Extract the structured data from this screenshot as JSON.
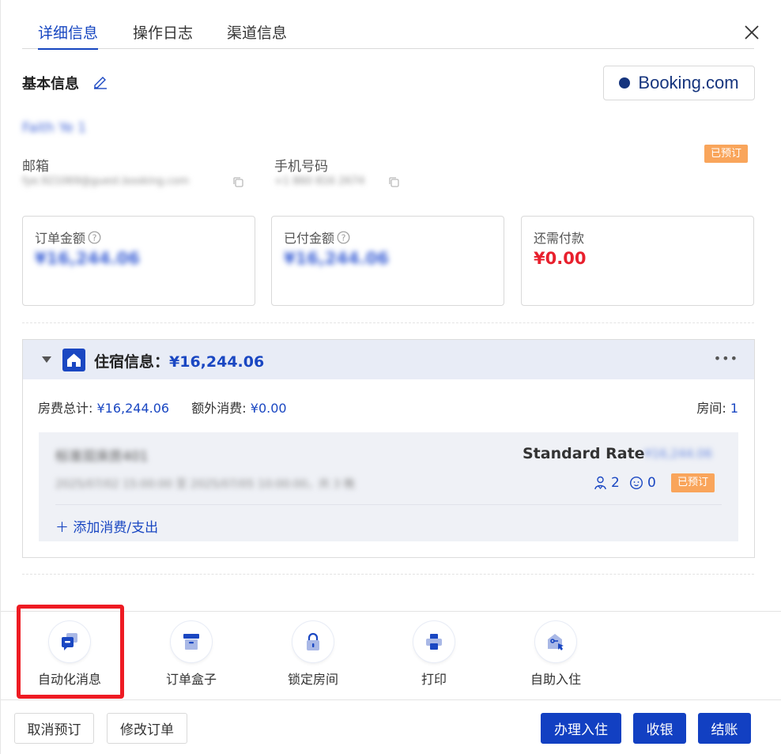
{
  "tabs": [
    "详细信息",
    "操作日志",
    "渠道信息"
  ],
  "basic": {
    "title": "基本信息",
    "channel": "Booking.com",
    "guest_name": "Faith Ye 1",
    "status": "已预订",
    "email_label": "邮箱",
    "email_value": "fye.921069@guest.booking.com",
    "phone_label": "手机号码",
    "phone_value": "+1 860 816 2674"
  },
  "amounts": {
    "order_label": "订单金额",
    "order_value": "¥16,244.06",
    "paid_label": "已付金额",
    "paid_value": "¥16,244.06",
    "due_label": "还需付款",
    "due_value": "¥0.00"
  },
  "stay": {
    "title": "住宿信息：",
    "amount": "¥16,244.06",
    "more": "•••",
    "room_fee_label": "房费总计: ",
    "room_fee_value": "¥16,244.06",
    "extra_label": "额外消费: ",
    "extra_value": "¥0.00",
    "rooms_label": "房间: ",
    "rooms_value": "1",
    "room": {
      "name": "标准双床房401",
      "rate": "Standard Rate",
      "rate_amount": "¥16,244.06",
      "dates": "2025/07/02 15:00:00 至 2025/07/05 10:00:00，共 3 晚",
      "adults": "2",
      "children": "0",
      "status": "已预订"
    },
    "add_expense": "＋ 添加消费/支出"
  },
  "toolbar": [
    "自动化消息",
    "订单盒子",
    "锁定房间",
    "打印",
    "自助入住"
  ],
  "footer": {
    "cancel": "取消预订",
    "modify": "修改订单",
    "checkin": "办理入住",
    "cashier": "收银",
    "checkout": "结账"
  },
  "colors": {
    "primary": "#1240c2",
    "tag": "#f9a55b",
    "danger": "#e8202d",
    "highlight": "#ee1b23"
  }
}
